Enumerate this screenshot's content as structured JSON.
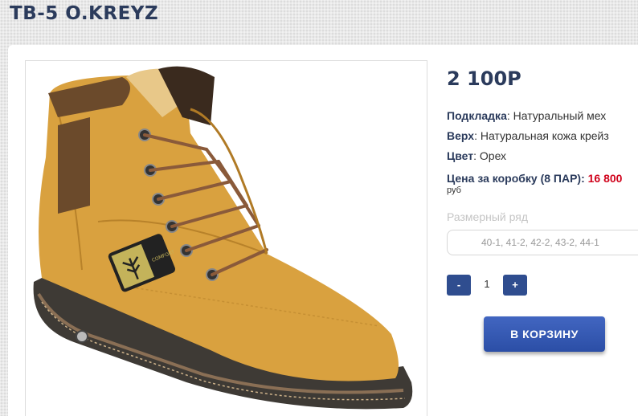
{
  "product": {
    "title": "TB-5 O.KREYZ",
    "price": "2 100P",
    "specs": [
      {
        "label": "Подкладка",
        "value": "Натуральный мех"
      },
      {
        "label": "Верх",
        "value": "Натуральная кожа крейз"
      },
      {
        "label": "Цвет",
        "value": "Орех"
      }
    ],
    "box_price_label": "Цена за коробку (8 ПАР):",
    "box_price_value": "16 800",
    "box_price_unit": "руб",
    "image_alt": "boot-photo"
  },
  "size_range": {
    "label": "Размерный ряд",
    "selected": "40-1, 41-2, 42-2, 43-2, 44-1"
  },
  "quantity": {
    "minus_label": "-",
    "value": "1",
    "plus_label": "+"
  },
  "cart_button": {
    "label": "В КОРЗИНУ"
  },
  "colors": {
    "brand": "#2b3b5c",
    "button": "#2f4d8f",
    "accent_red": "#d0021b"
  }
}
